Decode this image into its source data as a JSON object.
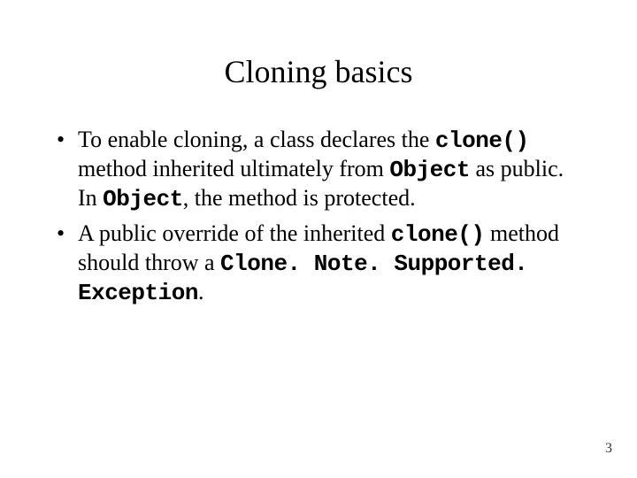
{
  "title": "Cloning basics",
  "bullets": [
    {
      "p0": "To enable cloning, a class declares the ",
      "c0": "clone()",
      "p1": " method inherited ultimately from ",
      "c1": "Object",
      "p2": " as public. In ",
      "c2": "Object",
      "p3": ", the method is protected."
    },
    {
      "p0": "A public override of the inherited ",
      "c0": "clone()",
      "p1": " method should throw a ",
      "c1": "Clone. Note. Supported. Exception",
      "p2": "."
    }
  ],
  "page_number": "3"
}
